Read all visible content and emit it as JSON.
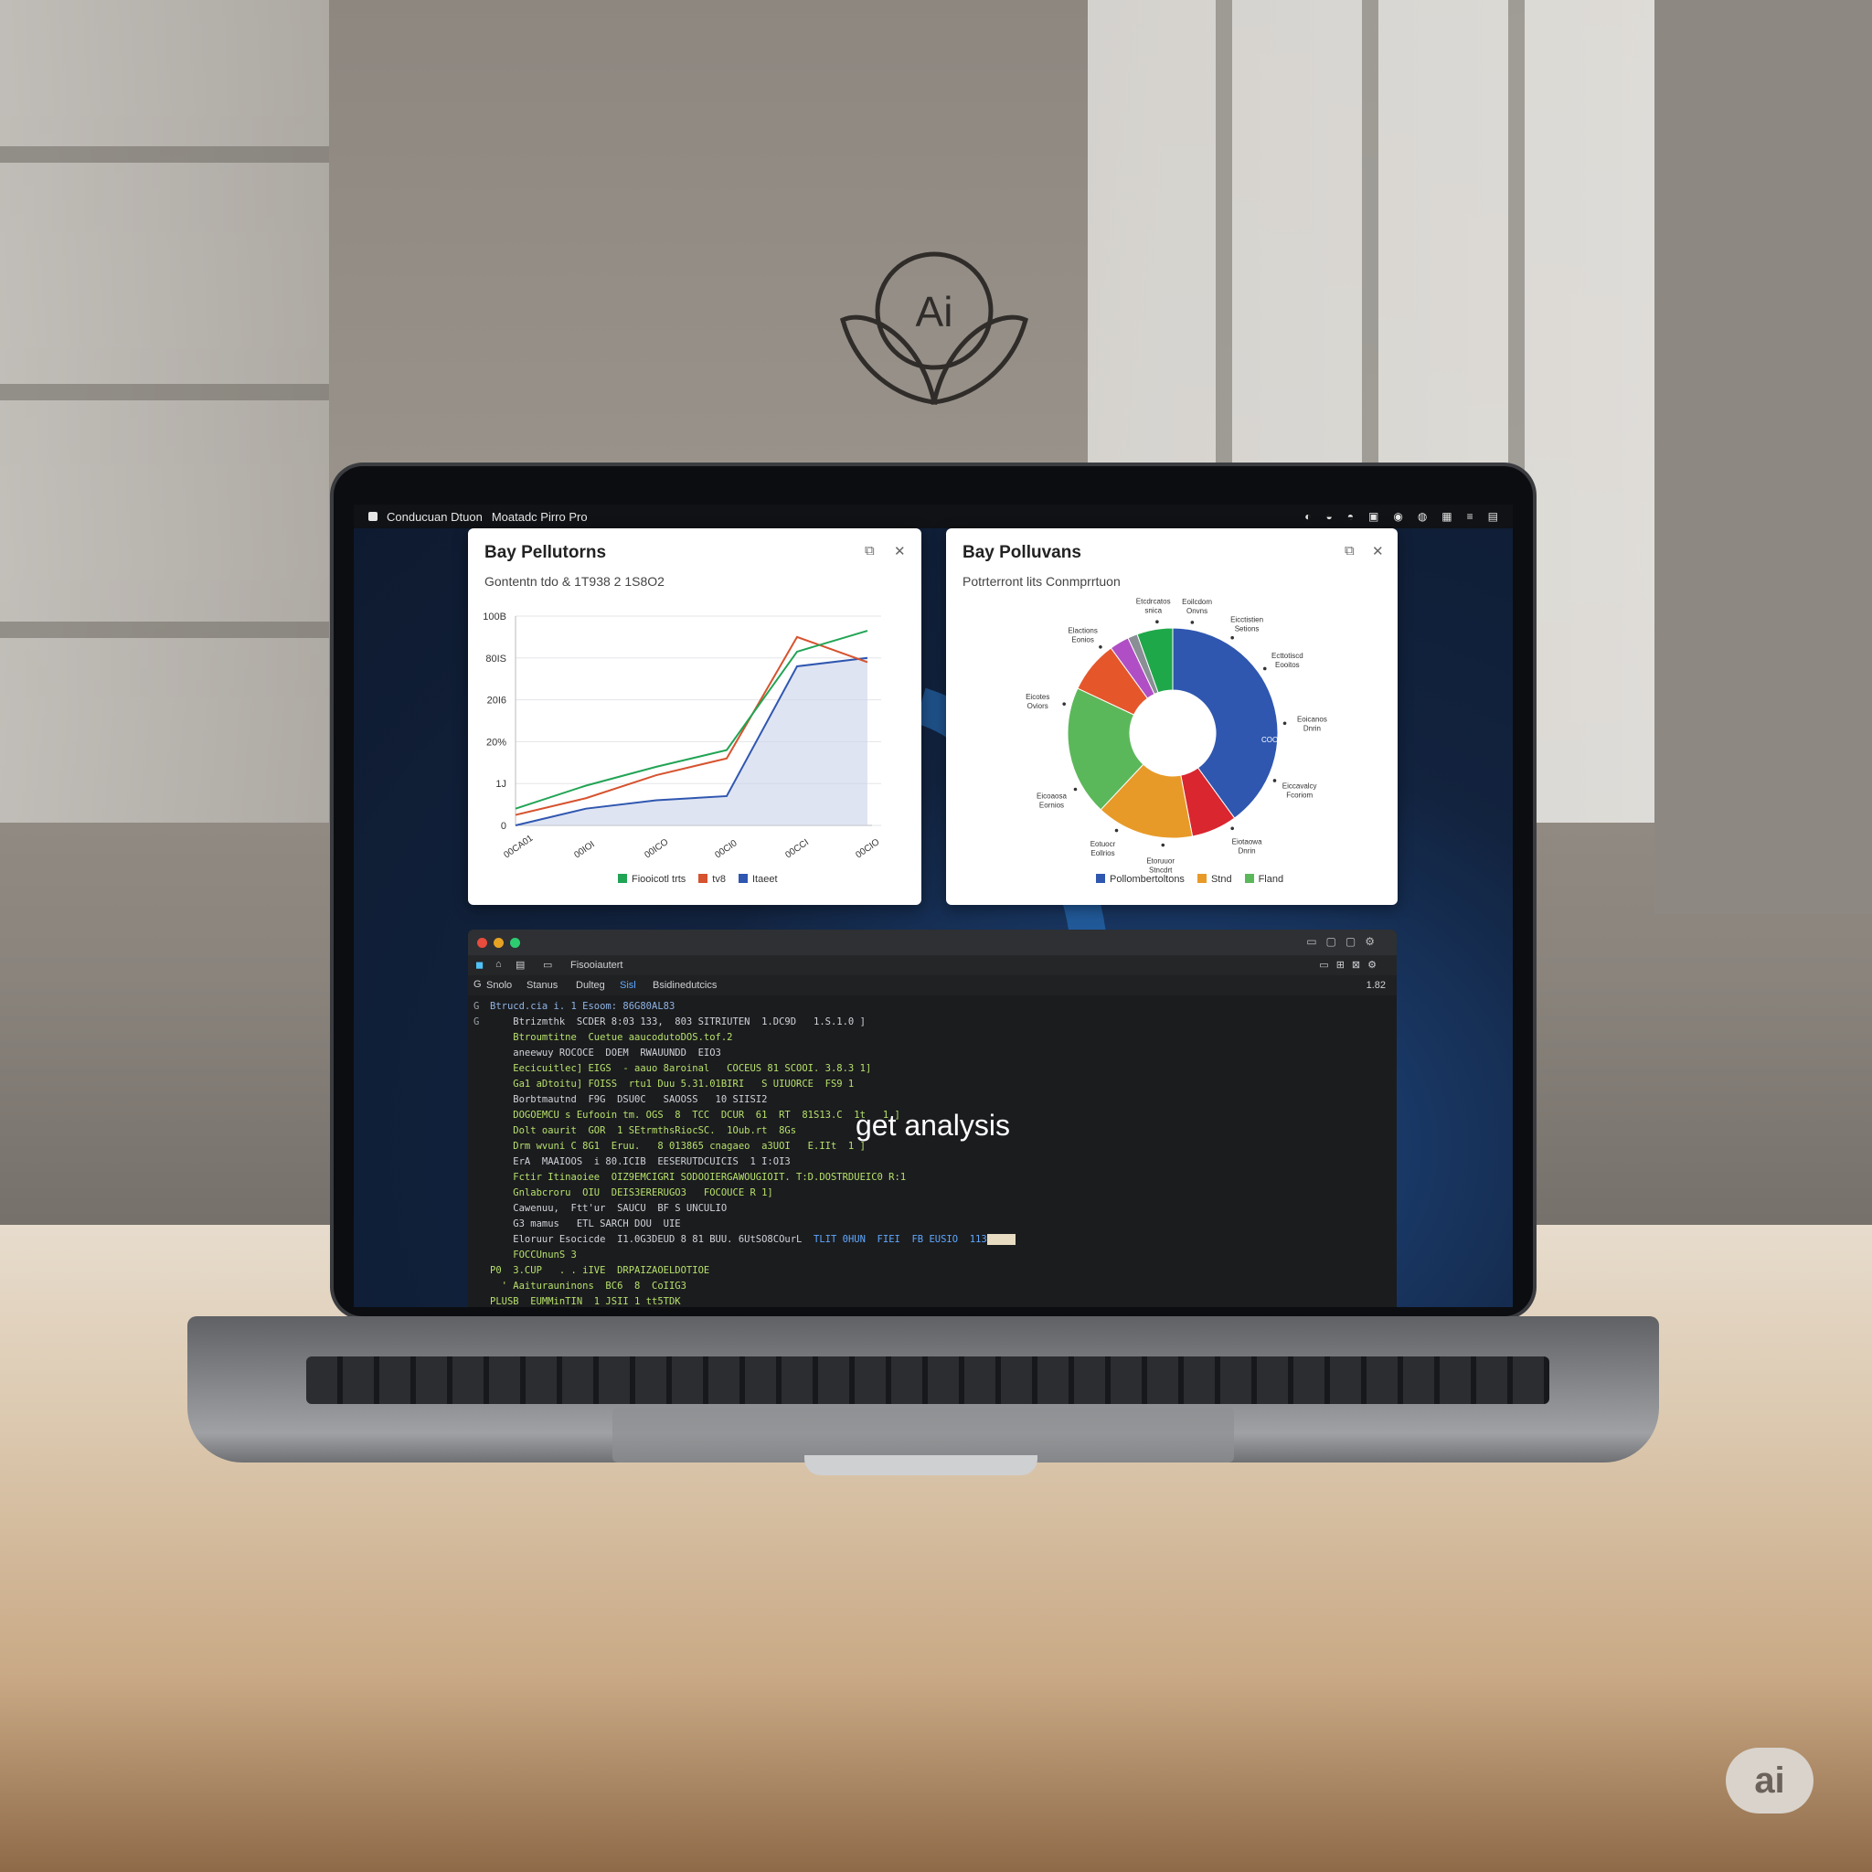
{
  "wall_logo_text": "Ai",
  "menubar": {
    "title1": "Conducuan Dtuon",
    "title2": "Moatadc Pirro Pro"
  },
  "line_card": {
    "title": "Bay Pellutorns",
    "subtitle": "Gontentn tdo & 1T938 2 1S8O2",
    "yticks": [
      "100B",
      "80IS",
      "20I6",
      "20%",
      "1J",
      "0"
    ],
    "xticks": [
      "00CA01",
      "00IOI",
      "00ICO",
      "00CI0",
      "00CCI",
      "00CIO"
    ],
    "legend": [
      {
        "label": "Fiooicotl trts",
        "color": "#22a455"
      },
      {
        "label": "tv8",
        "color": "#d6532f"
      },
      {
        "label": "Itaeet",
        "color": "#2f57b0"
      }
    ]
  },
  "pie_card": {
    "title": "Bay Polluvans",
    "subtitle": "Potrterront lits Conmprrtuon",
    "center_label": "COORIT",
    "legend": [
      {
        "label": "Pollombertoltons",
        "color": "#2f57b0"
      },
      {
        "label": "Stnd",
        "color": "#e89a28"
      },
      {
        "label": "Fland",
        "color": "#5bb85a"
      }
    ],
    "slice_labels": [
      "Eoilcdom\nOnvns",
      "Eicctistien\nSetions",
      "Ecttotiscd\nEooitos",
      "Eoicanos\nDnrin",
      "Eiccavalcy\nFcoriom",
      "Eiotaowa\nDnrin",
      "Etoruuor\nStncdrt",
      "Eotuocr\nEollrios",
      "Eicoaosa\nEornios",
      "Eicotes\nOviors",
      "Elactions\nEonios",
      "Etcdrcatos\nsnica"
    ]
  },
  "chart_data": [
    {
      "type": "line",
      "title": "Bay Pellutorns",
      "categories": [
        "00CA01",
        "00IOI",
        "00ICO",
        "00CI0",
        "00CCI",
        "00CIO"
      ],
      "series": [
        {
          "name": "Fiooicotl trts",
          "color": "#22a455",
          "values": [
            8,
            19,
            28,
            36,
            83,
            93
          ]
        },
        {
          "name": "tv8",
          "color": "#d6532f",
          "values": [
            5,
            13,
            24,
            32,
            90,
            78
          ]
        },
        {
          "name": "Itaeet",
          "color": "#2f57b0",
          "values": [
            0,
            8,
            12,
            14,
            76,
            80
          ],
          "filled": true
        }
      ],
      "ylim": [
        0,
        100
      ]
    },
    {
      "type": "pie",
      "title": "Bay Polluvans",
      "donut": true,
      "slices": [
        {
          "label": "Pollombertoltons",
          "value": 40,
          "color": "#2f57b0"
        },
        {
          "label": "red",
          "value": 7,
          "color": "#d9262f"
        },
        {
          "label": "Stnd",
          "value": 15,
          "color": "#e89a28"
        },
        {
          "label": "Fland",
          "value": 20,
          "color": "#5bb85a"
        },
        {
          "label": "orange",
          "value": 8,
          "color": "#e5572b"
        },
        {
          "label": "purple",
          "value": 3,
          "color": "#b04fc5"
        },
        {
          "label": "grey",
          "value": 1.5,
          "color": "#8a8f96"
        },
        {
          "label": "green",
          "value": 5.5,
          "color": "#1fa84a"
        }
      ]
    }
  ],
  "terminal": {
    "toolbar_label": "Fisooiautert",
    "tabs": [
      "Snolo",
      "Stanus",
      "Dulteg",
      "Sisl",
      "Bsidinedutcics"
    ],
    "tab_right": "1.82",
    "lines": [
      {
        "prefix": "G",
        "text": "Btrucd.cia i. 1 Esoom: 86G80AL83",
        "color": "#8fb4e6"
      },
      {
        "prefix": "G",
        "text": "    Btrizmthk  SCDER 8:03 133,  803 SITRIUTEN  1.DC9D   1.S.1.0 ]",
        "color": "#cfd3d8"
      },
      {
        "prefix": "",
        "text": "    Btroumtitne  Cuetue aaucodutoDOS.tof.2",
        "color": "#b6e06b"
      },
      {
        "prefix": "",
        "text": "    aneewuy ROCOCE  DOEM  RWAUUNDD  EIO3",
        "color": "#cfd3d8"
      },
      {
        "prefix": "",
        "text": "    Eecicuitlec] EIGS  - aauo 8aroinal   COCEUS 81 SCOOI. 3.8.3 1]",
        "color": "#b6e06b"
      },
      {
        "prefix": "",
        "text": "    Ga1 aDtoitu] FOISS  rtu1 Duu 5.31.01BIRI   S UIUORCE  FS9 1",
        "color": "#b6e06b"
      },
      {
        "prefix": "",
        "text": "    Borbtmautnd  F9G  DSU0C   SAOOSS   10 SIISI2",
        "color": "#cfd3d8"
      },
      {
        "prefix": "",
        "text": "    DOGOEMCU s Eufooin tm. OGS  8  TCC  DCUR  61  RT  81S13.C  1t   1 ]",
        "color": "#b6e06b"
      },
      {
        "prefix": "",
        "text": "    Dolt oaurit  GOR  1 SEtrmthsRiocSC.  1Oub.rt  8Gs",
        "color": "#b6e06b"
      },
      {
        "prefix": "",
        "text": "    Drm wvuni C 8G1  Eruu.   8 013865 cnagaeo  a3UOI   E.IIt  1 ]",
        "color": "#b6e06b"
      },
      {
        "prefix": "",
        "text": "    ErA  MAAIOOS  i 80.ICIB  EESERUTDCUICIS  1 I:OI3",
        "color": "#cfd3d8"
      },
      {
        "prefix": "",
        "text": "    Fctir Itinaoiee  OIZ9EMCIGRI SODOOIERGAWOUGIOIT. T:D.DOSTRDUEIC0 R:1",
        "color": "#b6e06b"
      },
      {
        "prefix": "",
        "text": "    Gnlabcroru  OIU  DEIS3ERERUGO3   FOCOUCE R 1]",
        "color": "#b6e06b"
      },
      {
        "prefix": "",
        "text": "    Cawenuu,  Ftt'ur  SAUCU  BF S UNCULIO",
        "color": "#cfd3d8"
      },
      {
        "prefix": "",
        "text": "    G3 mamus   ETL SARCH DOU  UIE",
        "color": "#cfd3d8"
      },
      {
        "prefix": "",
        "text": "    Eloruur Esocicde  I1.0G3DEUD 8 81 BUU. 6UtSO8COurL",
        "color": "#cfd3d8"
      },
      {
        "prefix": "",
        "text": "    FOCCUnunS 3",
        "color": "#b6e06b"
      },
      {
        "prefix": "",
        "text": "P0  3.CUP   . . iIVE  DRPAIZAOELDOTIOE",
        "color": "#b6e06b"
      },
      {
        "prefix": "",
        "text": "  ' Aaiturauninons  BC6  8  CoIIG3",
        "color": "#b6e06b"
      },
      {
        "prefix": "",
        "text": "PLUSB  EUMMinTIN  1 JSII 1 tt5TDK",
        "color": "#b6e06b"
      }
    ],
    "highlight_inline": "TLIT 0HUN  FIEI  FB EUSIO  113"
  },
  "overlay_caption": "get analysis",
  "corner_logo": "ai"
}
